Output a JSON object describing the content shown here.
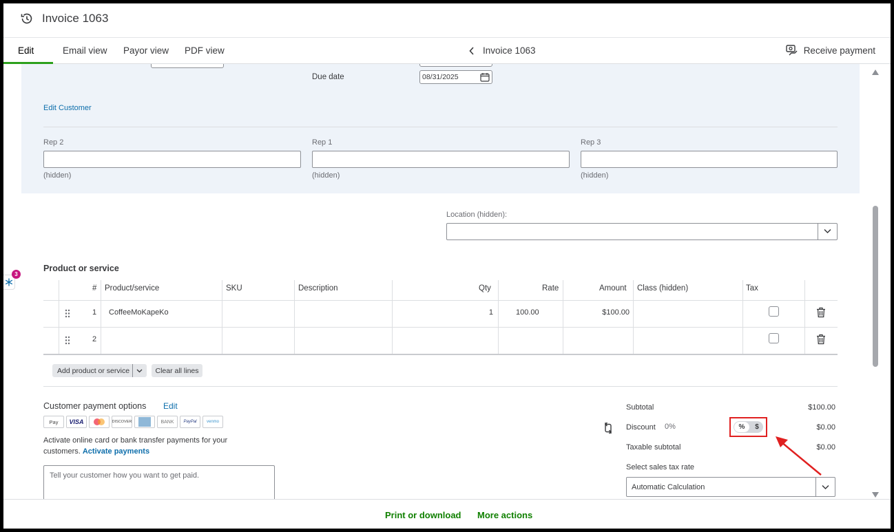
{
  "window": {
    "title": "Invoice 1063"
  },
  "tabs": [
    {
      "label": "Edit"
    },
    {
      "label": "Email view"
    },
    {
      "label": "Payor view"
    },
    {
      "label": "PDF view"
    }
  ],
  "nav": {
    "invoice_label": "Invoice 1063",
    "receive_payment": "Receive payment"
  },
  "header_form": {
    "due_date_label": "Due date",
    "due_date_value": "08/31/2025",
    "edit_customer": "Edit Customer",
    "reps": [
      {
        "label": "Rep 2",
        "note": "(hidden)"
      },
      {
        "label": "Rep 1",
        "note": "(hidden)"
      },
      {
        "label": "Rep 3",
        "note": "(hidden)"
      }
    ],
    "location_label": "Location (hidden):"
  },
  "products": {
    "section_title": "Product or service",
    "columns": [
      "#",
      "Product/service",
      "SKU",
      "Description",
      "Qty",
      "Rate",
      "Amount",
      "Class (hidden)",
      "Tax"
    ],
    "rows": [
      {
        "num": "1",
        "product": "CoffeeMoKapeKo",
        "sku": "",
        "description": "",
        "qty": "1",
        "rate": "100.00",
        "amount": "$100.00"
      },
      {
        "num": "2",
        "product": "",
        "sku": "",
        "description": "",
        "qty": "",
        "rate": "",
        "amount": ""
      }
    ],
    "add_button": "Add product or service",
    "clear_button": "Clear all lines"
  },
  "payment": {
    "title": "Customer payment options",
    "edit": "Edit",
    "logos": [
      "Pay",
      "VISA",
      "",
      "DISCOVER",
      "",
      "BANK",
      "PayPal",
      "venmo"
    ],
    "description": "Activate online card or bank transfer payments for your customers.",
    "activate": "Activate payments",
    "message_placeholder": "Tell your customer how you want to get paid."
  },
  "summary": {
    "subtotal_label": "Subtotal",
    "subtotal_value": "$100.00",
    "discount_label": "Discount",
    "discount_pct": "0%",
    "toggle_pct": "%",
    "toggle_dollar": "$",
    "discount_value": "$0.00",
    "taxable_label": "Taxable subtotal",
    "taxable_value": "$0.00",
    "tax_rate_label": "Select sales tax rate",
    "tax_rate_value": "Automatic Calculation"
  },
  "footer": {
    "print": "Print or download",
    "more": "More actions"
  },
  "badge": {
    "count": "3"
  },
  "colors": {
    "accent_green": "#2ca01c",
    "link_blue": "#0d6eab",
    "annotation_red": "#e02020",
    "form_bg": "#eef3f9"
  }
}
